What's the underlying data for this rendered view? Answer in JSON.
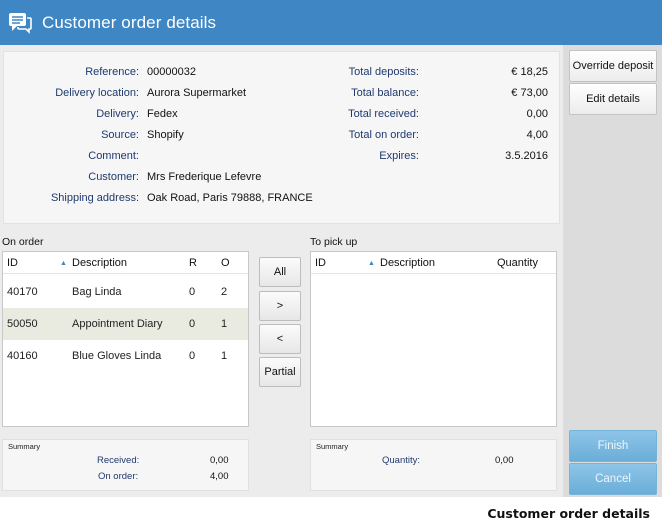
{
  "window": {
    "title": "Customer order details",
    "icon": "chat-bubbles-icon"
  },
  "info": {
    "left": [
      {
        "label": "Reference:",
        "value": "00000032"
      },
      {
        "label": "Delivery location:",
        "value": "Aurora Supermarket"
      },
      {
        "label": "Delivery:",
        "value": "Fedex"
      },
      {
        "label": "Source:",
        "value": "Shopify"
      },
      {
        "label": "Comment:",
        "value": ""
      },
      {
        "label": "Customer:",
        "value": "Mrs Frederique Lefevre"
      },
      {
        "label": "Shipping address:",
        "value": "Oak Road, Paris 79888, FRANCE"
      }
    ],
    "right": [
      {
        "label": "Total deposits:",
        "value": "€ 18,25"
      },
      {
        "label": "Total balance:",
        "value": "€ 73,00"
      },
      {
        "label": "Total received:",
        "value": "0,00"
      },
      {
        "label": "Total on order:",
        "value": "4,00"
      },
      {
        "label": "Expires:",
        "value": "3.5.2016"
      }
    ]
  },
  "on_order": {
    "title": "On order",
    "columns": {
      "id": "ID",
      "description": "Description",
      "r": "R",
      "o": "O"
    },
    "rows": [
      {
        "id": "40170",
        "description": "Bag Linda",
        "r": "0",
        "o": "2"
      },
      {
        "id": "50050",
        "description": "Appointment Diary",
        "r": "0",
        "o": "1"
      },
      {
        "id": "40160",
        "description": "Blue Gloves Linda",
        "r": "0",
        "o": "1"
      }
    ],
    "selected_index": 1,
    "summary": {
      "title": "Summary",
      "received_label": "Received:",
      "received_value": "0,00",
      "on_order_label": "On order:",
      "on_order_value": "4,00"
    }
  },
  "transfer_buttons": {
    "all": "All",
    "right": ">",
    "left": "<",
    "partial": "Partial"
  },
  "to_pick_up": {
    "title": "To pick up",
    "columns": {
      "id": "ID",
      "description": "Description",
      "quantity": "Quantity"
    },
    "rows": [],
    "summary": {
      "title": "Summary",
      "quantity_label": "Quantity:",
      "quantity_value": "0,00"
    }
  },
  "actions": {
    "override_deposit": "Override deposit",
    "edit_details": "Edit details",
    "finish": "Finish",
    "cancel": "Cancel"
  },
  "caption": "Customer order details",
  "colors": {
    "titlebar": "#3f86c4",
    "label_text": "#1f3a6e",
    "primary_button": "#7ab8e0"
  }
}
